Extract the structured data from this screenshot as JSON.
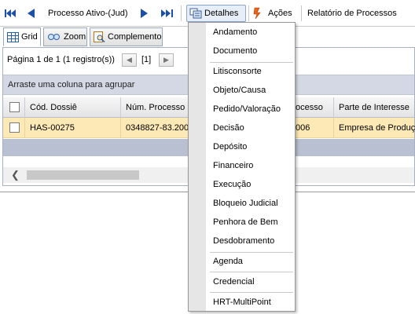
{
  "toolbar": {
    "nav_label": "Processo Ativo-(Jud)",
    "detalhes_label": "Detalhes",
    "acoes_label": "Ações",
    "relatorio_label": "Relatório de Processos"
  },
  "tabs": [
    {
      "label": "Grid",
      "icon": "grid-icon"
    },
    {
      "label": "Zoom",
      "icon": "zoom-icon"
    },
    {
      "label": "Complemento",
      "icon": "complement-icon"
    }
  ],
  "pager": {
    "text": "Página 1 de 1 (1 registro(s))",
    "current": "[1]"
  },
  "group_hint": "Arraste uma coluna para agrupar",
  "columns": [
    "Cód. Dossiê",
    "Núm. Processo",
    "ocesso",
    "Parte de Interesse"
  ],
  "rows": [
    [
      "HAS-00275",
      "0348827-83.200",
      "006",
      "Empresa de Produção"
    ]
  ],
  "menu": {
    "items": [
      "Andamento",
      "Documento",
      "Litisconsorte",
      "Objeto/Causa",
      "Pedido/Valoração",
      "Decisão",
      "Depósito",
      "Financeiro",
      "Execução",
      "Bloqueio Judicial",
      "Penhora de Bem",
      "Desdobramento",
      "Agenda",
      "Credencial",
      "HRT-MultiPoint"
    ]
  },
  "colors": {
    "accent": "#1c4fa8",
    "selected_row": "#fde9b6",
    "group_bar": "#d4d8e4"
  }
}
